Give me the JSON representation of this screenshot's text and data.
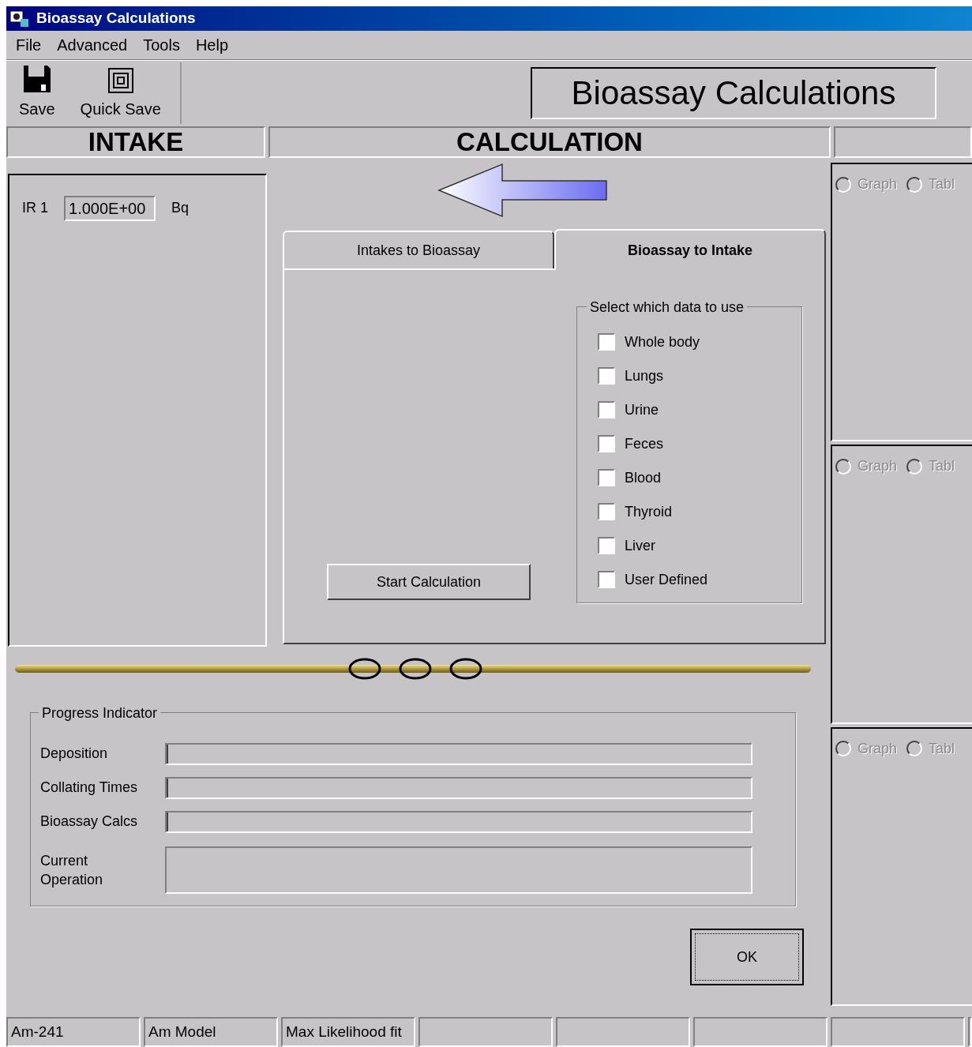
{
  "window": {
    "title": "Bioassay Calculations"
  },
  "menu": [
    "File",
    "Advanced",
    "Tools",
    "Help"
  ],
  "toolbar": [
    {
      "label": "Save",
      "kind": "disk"
    },
    {
      "label": "Quick Save",
      "kind": "frame"
    }
  ],
  "banner": "Bioassay Calculations",
  "sections": [
    "INTAKE",
    "CALCULATION"
  ],
  "intake": {
    "label": "IR 1",
    "value": "1.000E+00",
    "unit": "Bq"
  },
  "tabs": [
    {
      "label": "Intakes to Bioassay",
      "selected": false
    },
    {
      "label": "Bioassay to Intake",
      "selected": true
    }
  ],
  "data_group": {
    "title": "Select which data to use",
    "options": [
      {
        "label": "Whole body",
        "checked": false
      },
      {
        "label": "Lungs",
        "checked": false
      },
      {
        "label": "Urine",
        "checked": false
      },
      {
        "label": "Feces",
        "checked": false
      },
      {
        "label": "Blood",
        "checked": false
      },
      {
        "label": "Thyroid",
        "checked": false
      },
      {
        "label": "Liver",
        "checked": false
      },
      {
        "label": "User Defined",
        "checked": false
      }
    ]
  },
  "start_button": "Start Calculation",
  "progress": {
    "title": "Progress Indicator",
    "bars": [
      {
        "label": "Deposition",
        "level": 0
      },
      {
        "label": "Collating Times",
        "level": 0
      },
      {
        "label": "Bioassay Calcs",
        "level": 0
      }
    ],
    "current_label": "Current Operation"
  },
  "ok_button": "OK",
  "result_panels": [
    {
      "options": [
        {
          "label": "Graph",
          "selected": false
        },
        {
          "label": "Tabl",
          "selected": false
        }
      ]
    },
    {
      "options": [
        {
          "label": "Graph",
          "selected": false
        },
        {
          "label": "Tabl",
          "selected": false
        }
      ]
    },
    {
      "options": [
        {
          "label": "Graph",
          "selected": false
        },
        {
          "label": "Tabl",
          "selected": false
        }
      ]
    }
  ],
  "status_bar": [
    "Am-241",
    "Am Model",
    "Max Likelihood fit"
  ]
}
